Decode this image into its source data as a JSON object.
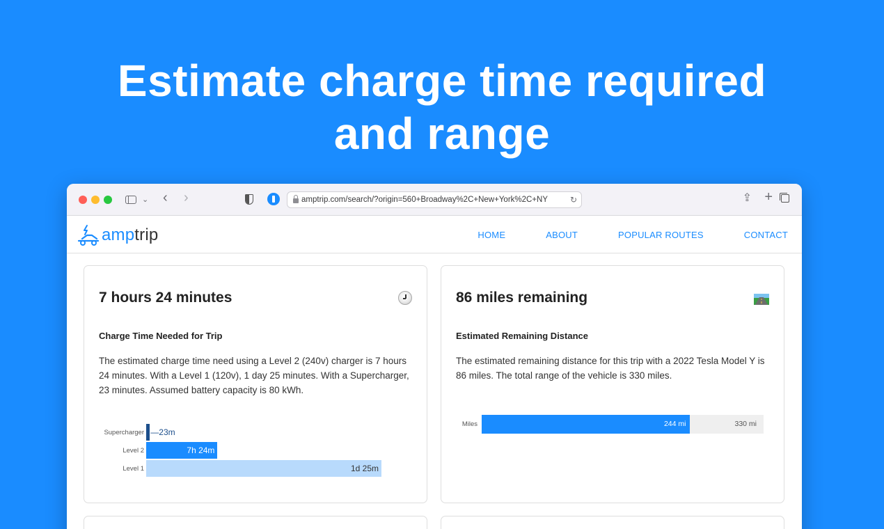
{
  "headline": {
    "line1": "Estimate charge time required",
    "line2": "and range"
  },
  "browser": {
    "url": "amptrip.com/search/?origin=560+Broadway%2C+New+York%2C+NY"
  },
  "site": {
    "logo_amp": "amp",
    "logo_trip": "trip",
    "nav": [
      "HOME",
      "ABOUT",
      "POPULAR ROUTES",
      "CONTACT"
    ],
    "brand_color": "#1a8cff"
  },
  "charge_card": {
    "title": "7 hours 24 minutes",
    "subtitle": "Charge Time Needed for Trip",
    "body": "The estimated charge time need using a Level 2 (240v) charger is 7 hours 24 minutes. With a Level 1 (120v), 1 day 25 minutes. With a Supercharger, 23 minutes. Assumed battery capacity is 80 kWh.",
    "icon": "clock-icon"
  },
  "range_card": {
    "title": "86 miles remaining",
    "subtitle": "Estimated Remaining Distance",
    "body": "The estimated remaining distance for this trip with a 2022 Tesla Model Y is 86 miles. The total range of the vehicle is 330 miles.",
    "icon": "road-icon"
  },
  "chart_data": [
    {
      "type": "bar",
      "orientation": "horizontal",
      "categories": [
        "Supercharger",
        "Level 2",
        "Level 1"
      ],
      "values_minutes": [
        23,
        444,
        1465
      ],
      "data_labels": [
        "23m",
        "7h 24m",
        "1d 25m"
      ],
      "colors": [
        "#1d4f8c",
        "#1a8cff",
        "#b8dafc"
      ]
    },
    {
      "type": "bar",
      "orientation": "horizontal",
      "categories": [
        "Miles"
      ],
      "values": [
        244
      ],
      "total": 330,
      "data_labels": [
        "244 mi",
        "330 mi"
      ],
      "colors": [
        "#1a8cff",
        "#efefef"
      ]
    }
  ]
}
